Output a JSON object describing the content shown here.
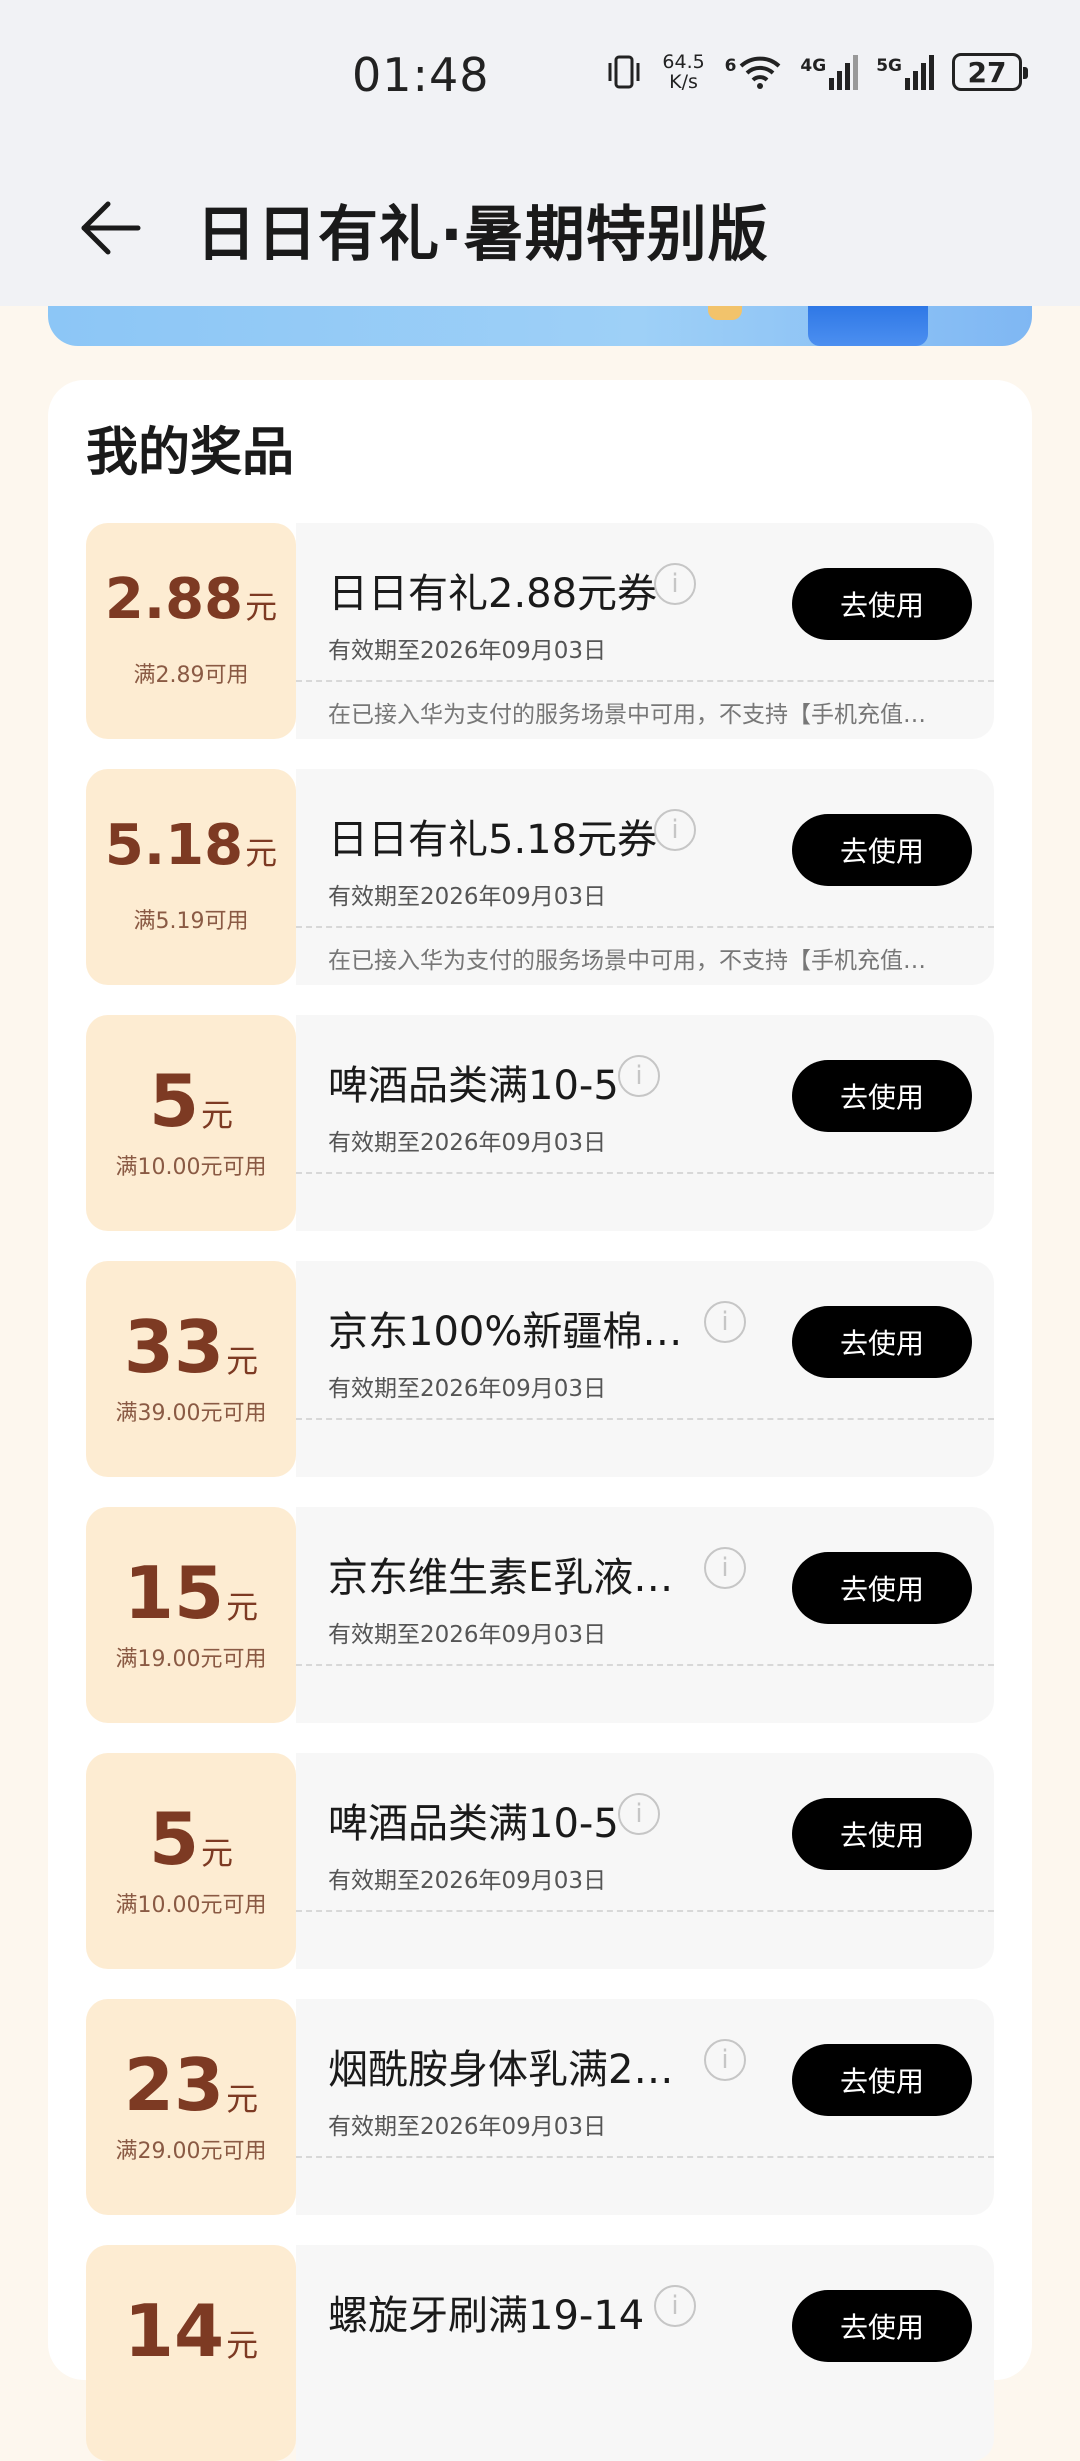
{
  "status_bar": {
    "time": "01:48",
    "net_speed_value": "64.5",
    "net_speed_unit": "K/s",
    "wifi_tag": "6",
    "signal_4g": "4G",
    "signal_5g": "5G",
    "battery": "27"
  },
  "header": {
    "title": "日日有礼·暑期特别版"
  },
  "prizes": {
    "section_title": "我的奖品",
    "use_label": "去使用",
    "items": [
      {
        "amount": "2.88",
        "unit": "元",
        "condition": "满2.89可用",
        "name": "日日有礼2.88元券",
        "expiry": "有效期至2026年09月03日",
        "desc": "在已接入华为支付的服务场景中可用，不支持【手机充值…"
      },
      {
        "amount": "5.18",
        "unit": "元",
        "condition": "满5.19可用",
        "name": "日日有礼5.18元券",
        "expiry": "有效期至2026年09月03日",
        "desc": "在已接入华为支付的服务场景中可用，不支持【手机充值…"
      },
      {
        "amount": "5",
        "unit": "元",
        "condition": "满10.00元可用",
        "name": "啤酒品类满10-5",
        "expiry": "有效期至2026年09月03日",
        "desc": ""
      },
      {
        "amount": "33",
        "unit": "元",
        "condition": "满39.00元可用",
        "name": "京东100%新疆棉…",
        "expiry": "有效期至2026年09月03日",
        "desc": ""
      },
      {
        "amount": "15",
        "unit": "元",
        "condition": "满19.00元可用",
        "name": "京东维生素E乳液…",
        "expiry": "有效期至2026年09月03日",
        "desc": ""
      },
      {
        "amount": "5",
        "unit": "元",
        "condition": "满10.00元可用",
        "name": "啤酒品类满10-5",
        "expiry": "有效期至2026年09月03日",
        "desc": ""
      },
      {
        "amount": "23",
        "unit": "元",
        "condition": "满29.00元可用",
        "name": "烟酰胺身体乳满2…",
        "expiry": "有效期至2026年09月03日",
        "desc": ""
      },
      {
        "amount": "14",
        "unit": "元",
        "condition": "",
        "name": "螺旋牙刷满19-14",
        "expiry": "",
        "desc": ""
      }
    ]
  }
}
